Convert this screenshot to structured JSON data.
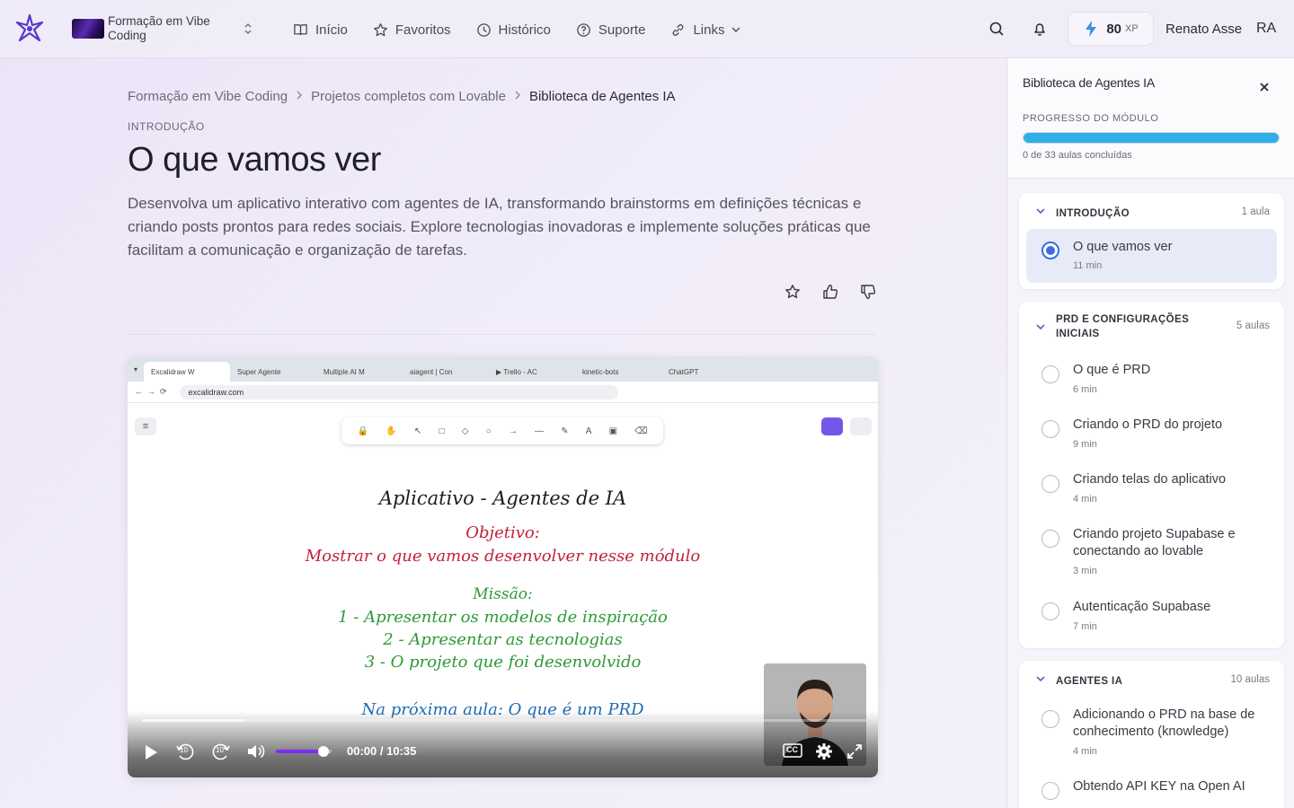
{
  "header": {
    "course_name": "Formação em Vibe Coding",
    "nav": [
      {
        "label": "Início",
        "icon": "book-icon"
      },
      {
        "label": "Favoritos",
        "icon": "star-icon"
      },
      {
        "label": "Histórico",
        "icon": "clock-icon"
      },
      {
        "label": "Suporte",
        "icon": "help-icon"
      },
      {
        "label": "Links",
        "icon": "link-icon"
      }
    ],
    "xp_value": "80",
    "xp_unit": "XP",
    "user_name": "Renato Asse",
    "user_initials": "RA"
  },
  "breadcrumb": [
    "Formação em Vibe Coding",
    "Projetos completos com Lovable",
    "Biblioteca de Agentes IA"
  ],
  "lesson": {
    "section": "INTRODUÇÃO",
    "title": "O que vamos ver",
    "description": "Desenvolva um aplicativo interativo com agentes de IA, transformando brainstorms em definições técnicas e criando posts prontos para redes sociais. Explore tecnologias inovadoras e implemente soluções práticas que facilitam a comunicação e organização de tarefas."
  },
  "video": {
    "browser_tabs": [
      "Excalidraw W",
      "Super Agente",
      "Multiple AI M",
      "aiagent | Con",
      "▶ Trello - AC",
      "kinetic-bots",
      "ChatGPT"
    ],
    "url": "excalidraw.com",
    "lines": [
      "Aplicativo - Agentes de IA",
      "Objetivo:",
      "Mostrar o que vamos desenvolver nesse módulo",
      "Missão:",
      "1 - Apresentar os modelos de inspiração",
      "2 - Apresentar as tecnologias",
      "3 - O projeto que foi desenvolvido",
      "Na próxima aula: O que é um PRD"
    ],
    "rewind_label": "10",
    "forward_label": "10",
    "cc_label": "CC",
    "time": "00:00 / 10:35",
    "volume": 0.85,
    "seek_buffered": 0.14
  },
  "sidebar": {
    "title": "Biblioteca de Agentes IA",
    "progress_label": "PROGRESSO DO MÓDULO",
    "progress_text": "0 de 33 aulas concluídas",
    "progress": 1.0,
    "modules": [
      {
        "title": "INTRODUÇÃO",
        "count": "1 aula",
        "lessons": [
          {
            "title": "O que vamos ver",
            "duration": "11 min",
            "active": true
          }
        ]
      },
      {
        "title": "PRD E CONFIGURAÇÕES INICIAIS",
        "count": "5 aulas",
        "lessons": [
          {
            "title": "O que é PRD",
            "duration": "6 min"
          },
          {
            "title": "Criando o PRD do projeto",
            "duration": "9 min"
          },
          {
            "title": "Criando telas do aplicativo",
            "duration": "4 min"
          },
          {
            "title": "Criando projeto Supabase e conectando ao lovable",
            "duration": "3 min"
          },
          {
            "title": "Autenticação Supabase",
            "duration": "7 min"
          }
        ]
      },
      {
        "title": "AGENTES IA",
        "count": "10 aulas",
        "lessons": [
          {
            "title": "Adicionando o PRD na base de conhecimento (knowledge)",
            "duration": "4 min"
          },
          {
            "title": "Obtendo API KEY na Open AI",
            "duration": ""
          }
        ]
      }
    ]
  }
}
